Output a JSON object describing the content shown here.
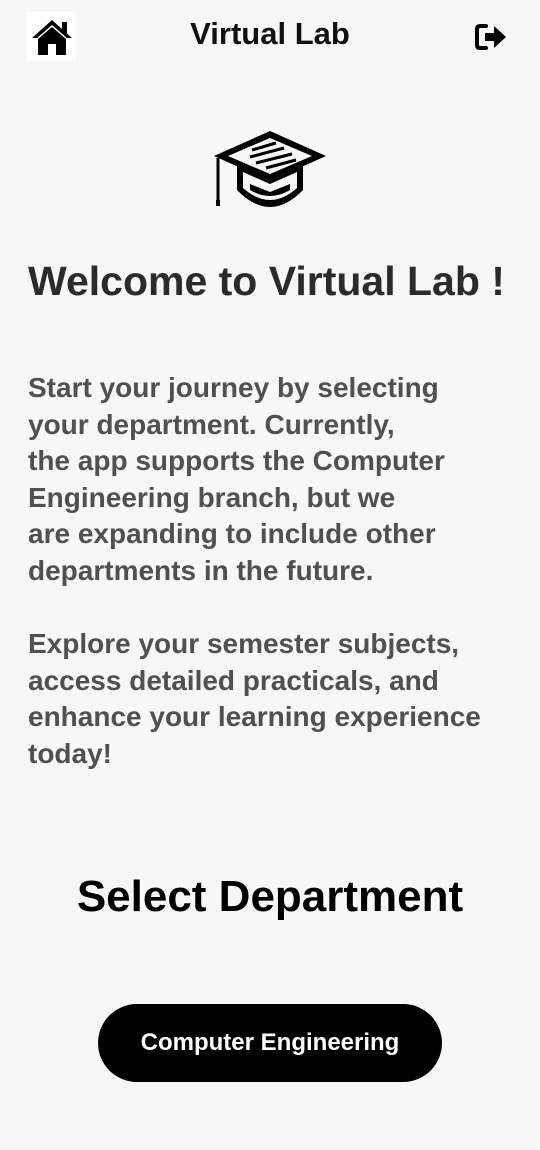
{
  "header": {
    "title": "Virtual Lab",
    "home_icon": "home-icon",
    "logout_icon": "sign-out-icon"
  },
  "hero": {
    "icon": "graduation-cap-icon"
  },
  "welcome": {
    "heading": "Welcome to Virtual Lab !",
    "intro_lines": [
      "Start your journey by selecting",
      "your department. Currently,",
      "the app supports the Computer",
      "Engineering branch, but we",
      "are expanding to include other",
      "departments in the future."
    ],
    "explore_lines": [
      "Explore your semester subjects,",
      "access detailed practicals, and",
      "enhance your learning experience",
      "today!"
    ]
  },
  "department": {
    "heading": "Select Department",
    "button_label": "Computer Engineering"
  },
  "colors": {
    "background": "#f7f7f7",
    "primary_button": "#000000",
    "body_text": "#505050"
  }
}
